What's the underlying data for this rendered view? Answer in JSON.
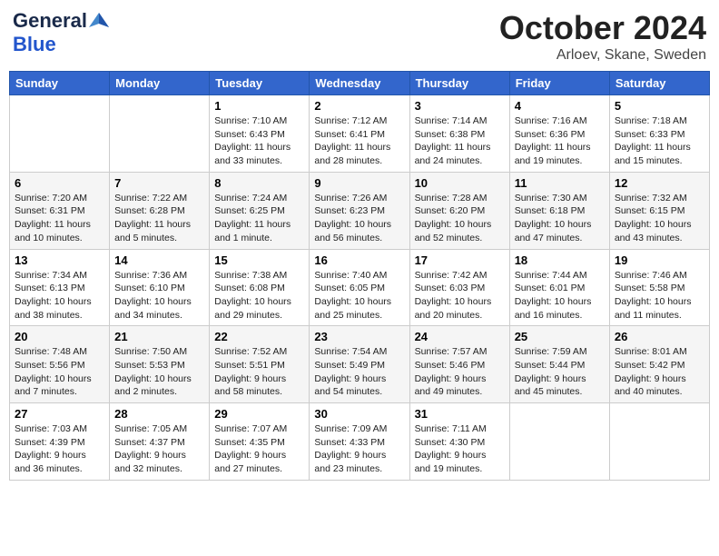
{
  "header": {
    "logo_general": "General",
    "logo_blue": "Blue",
    "title": "October 2024",
    "subtitle": "Arloev, Skane, Sweden"
  },
  "calendar": {
    "days_of_week": [
      "Sunday",
      "Monday",
      "Tuesday",
      "Wednesday",
      "Thursday",
      "Friday",
      "Saturday"
    ],
    "weeks": [
      [
        {
          "day": "",
          "info": ""
        },
        {
          "day": "",
          "info": ""
        },
        {
          "day": "1",
          "info": "Sunrise: 7:10 AM\nSunset: 6:43 PM\nDaylight: 11 hours\nand 33 minutes."
        },
        {
          "day": "2",
          "info": "Sunrise: 7:12 AM\nSunset: 6:41 PM\nDaylight: 11 hours\nand 28 minutes."
        },
        {
          "day": "3",
          "info": "Sunrise: 7:14 AM\nSunset: 6:38 PM\nDaylight: 11 hours\nand 24 minutes."
        },
        {
          "day": "4",
          "info": "Sunrise: 7:16 AM\nSunset: 6:36 PM\nDaylight: 11 hours\nand 19 minutes."
        },
        {
          "day": "5",
          "info": "Sunrise: 7:18 AM\nSunset: 6:33 PM\nDaylight: 11 hours\nand 15 minutes."
        }
      ],
      [
        {
          "day": "6",
          "info": "Sunrise: 7:20 AM\nSunset: 6:31 PM\nDaylight: 11 hours\nand 10 minutes."
        },
        {
          "day": "7",
          "info": "Sunrise: 7:22 AM\nSunset: 6:28 PM\nDaylight: 11 hours\nand 5 minutes."
        },
        {
          "day": "8",
          "info": "Sunrise: 7:24 AM\nSunset: 6:25 PM\nDaylight: 11 hours\nand 1 minute."
        },
        {
          "day": "9",
          "info": "Sunrise: 7:26 AM\nSunset: 6:23 PM\nDaylight: 10 hours\nand 56 minutes."
        },
        {
          "day": "10",
          "info": "Sunrise: 7:28 AM\nSunset: 6:20 PM\nDaylight: 10 hours\nand 52 minutes."
        },
        {
          "day": "11",
          "info": "Sunrise: 7:30 AM\nSunset: 6:18 PM\nDaylight: 10 hours\nand 47 minutes."
        },
        {
          "day": "12",
          "info": "Sunrise: 7:32 AM\nSunset: 6:15 PM\nDaylight: 10 hours\nand 43 minutes."
        }
      ],
      [
        {
          "day": "13",
          "info": "Sunrise: 7:34 AM\nSunset: 6:13 PM\nDaylight: 10 hours\nand 38 minutes."
        },
        {
          "day": "14",
          "info": "Sunrise: 7:36 AM\nSunset: 6:10 PM\nDaylight: 10 hours\nand 34 minutes."
        },
        {
          "day": "15",
          "info": "Sunrise: 7:38 AM\nSunset: 6:08 PM\nDaylight: 10 hours\nand 29 minutes."
        },
        {
          "day": "16",
          "info": "Sunrise: 7:40 AM\nSunset: 6:05 PM\nDaylight: 10 hours\nand 25 minutes."
        },
        {
          "day": "17",
          "info": "Sunrise: 7:42 AM\nSunset: 6:03 PM\nDaylight: 10 hours\nand 20 minutes."
        },
        {
          "day": "18",
          "info": "Sunrise: 7:44 AM\nSunset: 6:01 PM\nDaylight: 10 hours\nand 16 minutes."
        },
        {
          "day": "19",
          "info": "Sunrise: 7:46 AM\nSunset: 5:58 PM\nDaylight: 10 hours\nand 11 minutes."
        }
      ],
      [
        {
          "day": "20",
          "info": "Sunrise: 7:48 AM\nSunset: 5:56 PM\nDaylight: 10 hours\nand 7 minutes."
        },
        {
          "day": "21",
          "info": "Sunrise: 7:50 AM\nSunset: 5:53 PM\nDaylight: 10 hours\nand 2 minutes."
        },
        {
          "day": "22",
          "info": "Sunrise: 7:52 AM\nSunset: 5:51 PM\nDaylight: 9 hours\nand 58 minutes."
        },
        {
          "day": "23",
          "info": "Sunrise: 7:54 AM\nSunset: 5:49 PM\nDaylight: 9 hours\nand 54 minutes."
        },
        {
          "day": "24",
          "info": "Sunrise: 7:57 AM\nSunset: 5:46 PM\nDaylight: 9 hours\nand 49 minutes."
        },
        {
          "day": "25",
          "info": "Sunrise: 7:59 AM\nSunset: 5:44 PM\nDaylight: 9 hours\nand 45 minutes."
        },
        {
          "day": "26",
          "info": "Sunrise: 8:01 AM\nSunset: 5:42 PM\nDaylight: 9 hours\nand 40 minutes."
        }
      ],
      [
        {
          "day": "27",
          "info": "Sunrise: 7:03 AM\nSunset: 4:39 PM\nDaylight: 9 hours\nand 36 minutes."
        },
        {
          "day": "28",
          "info": "Sunrise: 7:05 AM\nSunset: 4:37 PM\nDaylight: 9 hours\nand 32 minutes."
        },
        {
          "day": "29",
          "info": "Sunrise: 7:07 AM\nSunset: 4:35 PM\nDaylight: 9 hours\nand 27 minutes."
        },
        {
          "day": "30",
          "info": "Sunrise: 7:09 AM\nSunset: 4:33 PM\nDaylight: 9 hours\nand 23 minutes."
        },
        {
          "day": "31",
          "info": "Sunrise: 7:11 AM\nSunset: 4:30 PM\nDaylight: 9 hours\nand 19 minutes."
        },
        {
          "day": "",
          "info": ""
        },
        {
          "day": "",
          "info": ""
        }
      ]
    ]
  }
}
